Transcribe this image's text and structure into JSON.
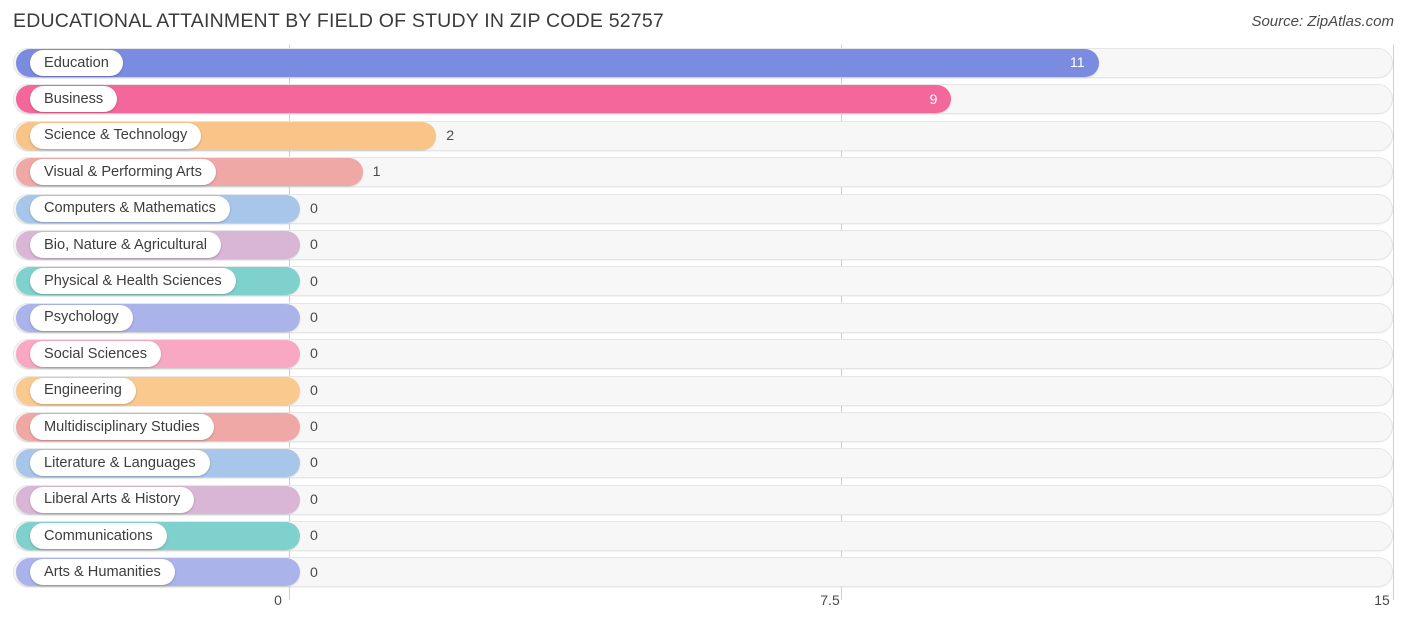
{
  "header": {
    "title": "EDUCATIONAL ATTAINMENT BY FIELD OF STUDY IN ZIP CODE 52757",
    "source": "Source: ZipAtlas.com"
  },
  "chart_data": {
    "type": "bar",
    "orientation": "horizontal",
    "title": "EDUCATIONAL ATTAINMENT BY FIELD OF STUDY IN ZIP CODE 52757",
    "xlabel": "",
    "ylabel": "",
    "xlim": [
      0,
      15
    ],
    "grid": true,
    "legend": "none",
    "xticks": [
      "0",
      "7.5",
      "15"
    ],
    "xtick_values": [
      0,
      7.5,
      15
    ],
    "categories": [
      "Education",
      "Business",
      "Science & Technology",
      "Visual & Performing Arts",
      "Computers & Mathematics",
      "Bio, Nature & Agricultural",
      "Physical & Health Sciences",
      "Psychology",
      "Social Sciences",
      "Engineering",
      "Multidisciplinary Studies",
      "Literature & Languages",
      "Liberal Arts & History",
      "Communications",
      "Arts & Humanities"
    ],
    "values": [
      11,
      9,
      2,
      1,
      0,
      0,
      0,
      0,
      0,
      0,
      0,
      0,
      0,
      0,
      0
    ],
    "value_labels": [
      "11",
      "9",
      "2",
      "1",
      "0",
      "0",
      "0",
      "0",
      "0",
      "0",
      "0",
      "0",
      "0",
      "0",
      "0"
    ],
    "colors": [
      "#7b8ce0",
      "#f4679a",
      "#f8c487",
      "#efa8a5",
      "#a8c6ea",
      "#d9b6d6",
      "#7fd1cd",
      "#aab4ea",
      "#f9a8c4",
      "#fac98e",
      "#efa8a5",
      "#a8c6ea",
      "#d9b6d6",
      "#7fd1cd",
      "#aab4ea"
    ]
  },
  "style": {
    "track_bg": "#f7f7f7",
    "track_border": "#e6e6e6",
    "grid_color": "#cfcfcf",
    "text_color": "#3d3d3d"
  }
}
